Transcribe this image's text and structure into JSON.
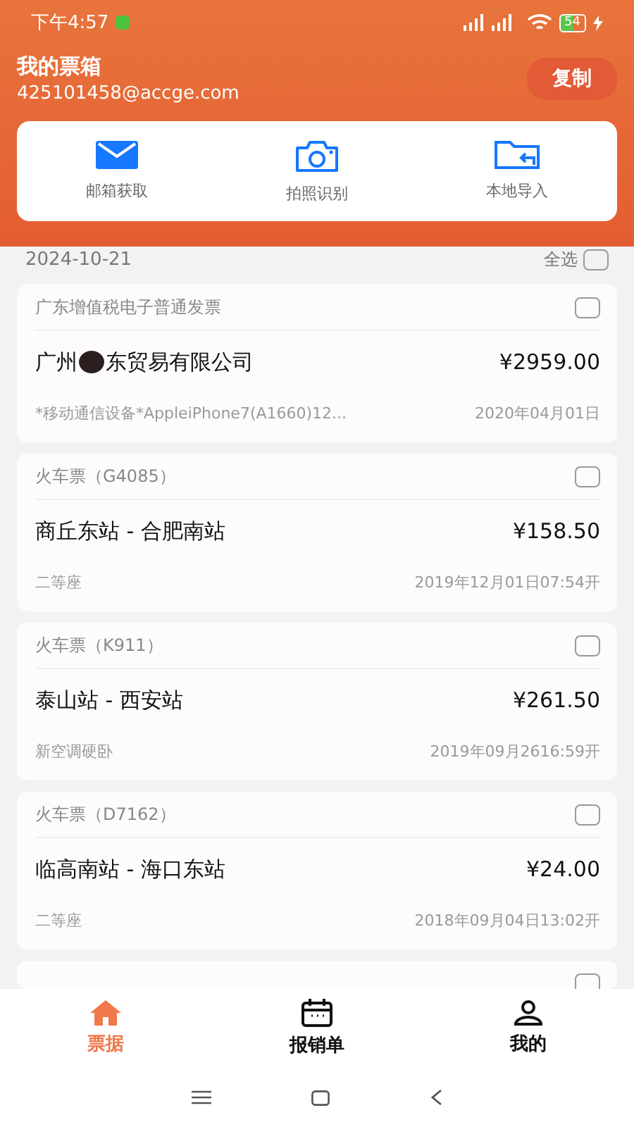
{
  "status_bar": {
    "time": "下午4:57",
    "battery": "54"
  },
  "header": {
    "title": "我的票箱",
    "email": "425101458@accge.com",
    "copy_button": "复制"
  },
  "actions": [
    {
      "kind": "mail",
      "label": "邮箱获取"
    },
    {
      "kind": "camera",
      "label": "拍照识别"
    },
    {
      "kind": "folder",
      "label": "本地导入"
    }
  ],
  "list_header": {
    "date": "2024-10-21",
    "select_all": "全选",
    "checked": false
  },
  "cards": [
    {
      "kind": "invoice",
      "type": "广东增值税电子普通发票",
      "title_parts": [
        "广州",
        "东贸易有限公司"
      ],
      "amount": "¥2959.00",
      "detail": "*移动通信设备*AppleiPhone7(A1660)12...",
      "date": "2020年04月01日",
      "checked": false
    },
    {
      "kind": "train",
      "type": "火车票（G4085）",
      "title_parts": [
        "商丘东站 - 合肥南站"
      ],
      "amount": "¥158.50",
      "detail": "二等座",
      "date": "2019年12月01日07:54开",
      "checked": false
    },
    {
      "kind": "train",
      "type": "火车票（K911）",
      "title_parts": [
        "泰山站 - 西安站"
      ],
      "amount": "¥261.50",
      "detail": "新空调硬卧",
      "date": "2019年09月2616:59开",
      "checked": false
    },
    {
      "kind": "train",
      "type": "火车票（D7162）",
      "title_parts": [
        "临高南站 - 海口东站"
      ],
      "amount": "¥24.00",
      "detail": "二等座",
      "date": "2018年09月04日13:02开",
      "checked": false
    },
    {
      "kind": "stub",
      "checked": false
    }
  ],
  "tabs": [
    {
      "kind": "home",
      "label": "票据",
      "selected": true
    },
    {
      "kind": "calendar",
      "label": "报销单",
      "selected": false
    },
    {
      "kind": "person",
      "label": "我的",
      "selected": false
    }
  ]
}
